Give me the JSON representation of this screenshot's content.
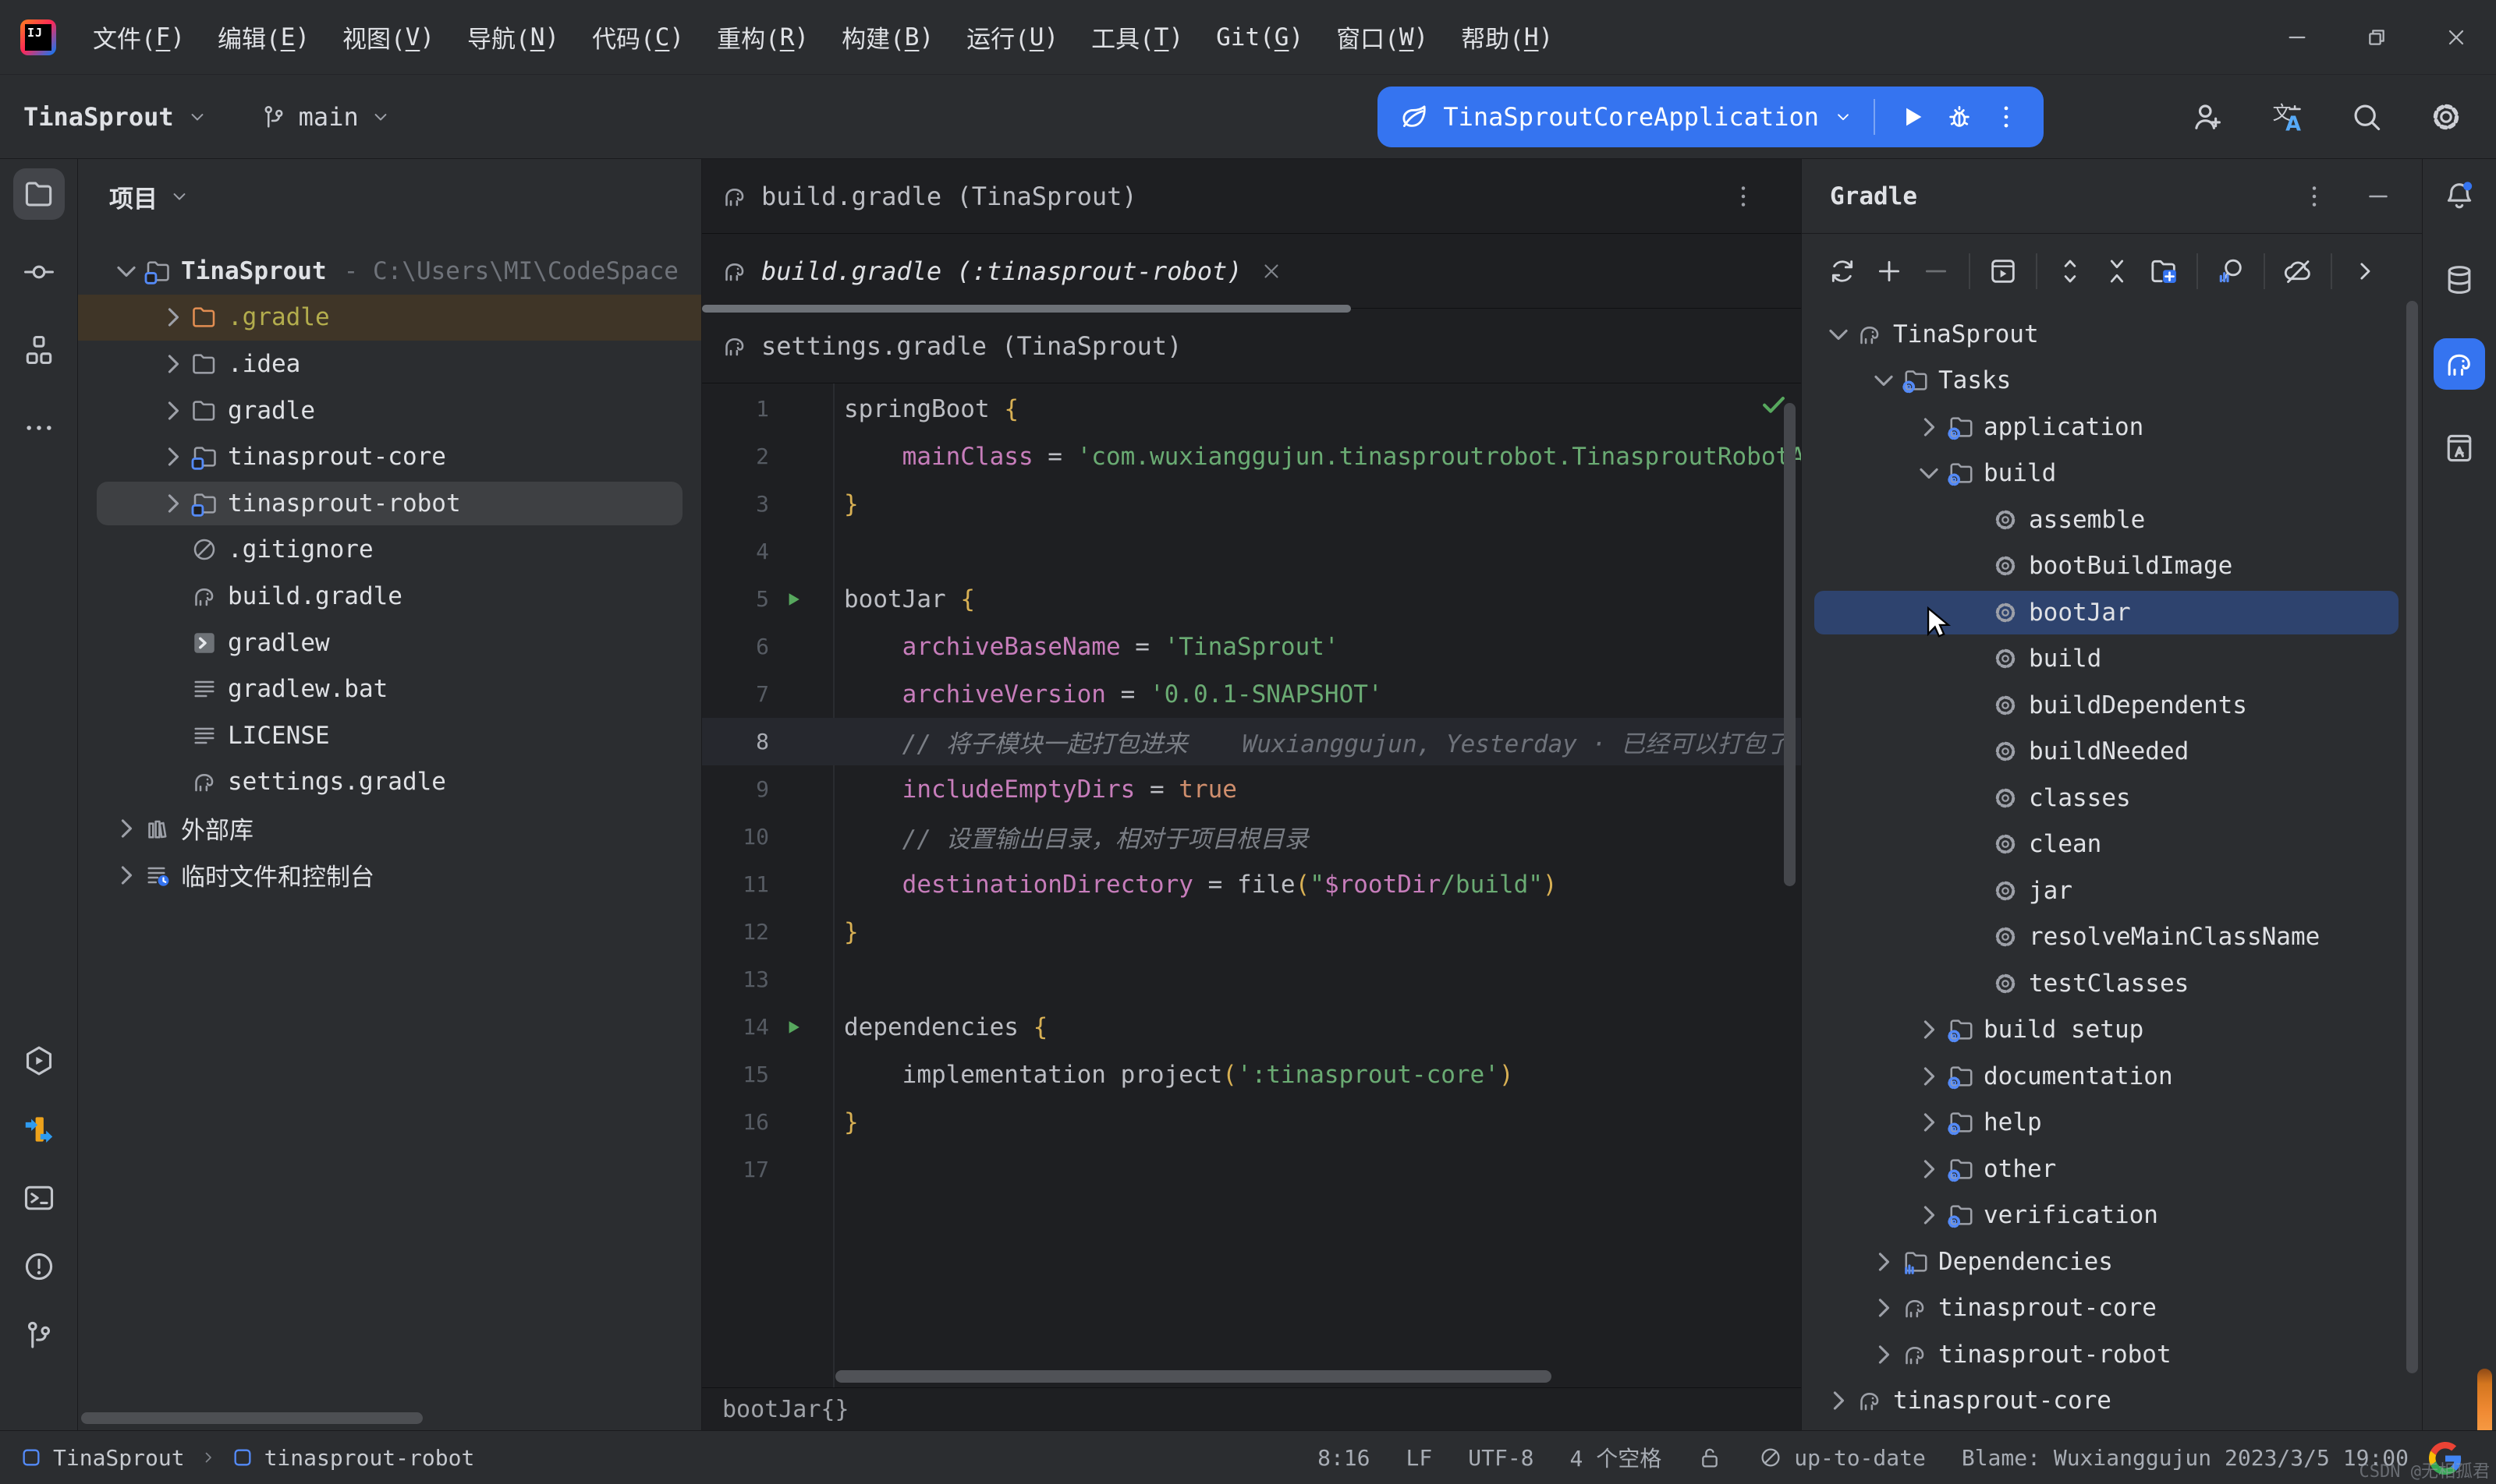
{
  "colors": {
    "accent": "#3574f0",
    "selection": "#2e436e",
    "run-green": "#57a85e",
    "ignored-bg": "#3f3527",
    "ignored-fg": "#b3ad4d",
    "kw": "#c77dbb",
    "str": "#6aab73",
    "num": "#cf8e6d",
    "cmt": "#7a7e85",
    "brace": "#d8b054"
  },
  "titlebar": {
    "logo_text": "IJ",
    "menu": [
      {
        "label": "文件",
        "mnemonic": "F"
      },
      {
        "label": "编辑",
        "mnemonic": "E"
      },
      {
        "label": "视图",
        "mnemonic": "V"
      },
      {
        "label": "导航",
        "mnemonic": "N"
      },
      {
        "label": "代码",
        "mnemonic": "C"
      },
      {
        "label": "重构",
        "mnemonic": "R"
      },
      {
        "label": "构建",
        "mnemonic": "B"
      },
      {
        "label": "运行",
        "mnemonic": "U"
      },
      {
        "label": "工具",
        "mnemonic": "T"
      },
      {
        "label": "Git",
        "mnemonic": "G"
      },
      {
        "label": "窗口",
        "mnemonic": "W"
      },
      {
        "label": "帮助",
        "mnemonic": "H"
      }
    ],
    "window_buttons": [
      "win-minimize",
      "win-restore",
      "win-close"
    ]
  },
  "toolbar": {
    "project_button": "TinaSprout",
    "branch_button": "main",
    "run_config": "TinaSproutCoreApplication",
    "run_buttons": [
      "run",
      "debug",
      "more-vertical"
    ],
    "right_icons": [
      "add-user",
      "translate",
      "search-everywhere",
      "settings"
    ]
  },
  "left_stripe": {
    "top": [
      {
        "icon": "project-folder",
        "active": true
      },
      {
        "icon": "commit"
      },
      {
        "icon": "structure"
      },
      {
        "icon": "more-horizontal"
      }
    ],
    "bottom": [
      {
        "icon": "services"
      },
      {
        "icon": "plugin"
      },
      {
        "icon": "terminal"
      },
      {
        "icon": "problems"
      },
      {
        "icon": "git-branch"
      }
    ]
  },
  "right_stripe": {
    "icons": [
      {
        "icon": "notifications",
        "badge": true
      },
      {
        "icon": "database"
      },
      {
        "icon": "gradle-logo",
        "active": true
      },
      {
        "icon": "documentation"
      }
    ]
  },
  "project_panel": {
    "title": "项目",
    "tree": [
      {
        "label": "TinaSprout",
        "icon": "module-folder",
        "level": 0,
        "chevron": "down",
        "bold": true,
        "suffix": "- C:\\Users\\MI\\CodeSpace"
      },
      {
        "label": ".gradle",
        "icon": "folder",
        "level": 1,
        "chevron": "right",
        "state": "ignored"
      },
      {
        "label": ".idea",
        "icon": "folder",
        "level": 1,
        "chevron": "right"
      },
      {
        "label": "gradle",
        "icon": "folder",
        "level": 1,
        "chevron": "right"
      },
      {
        "label": "tinasprout-core",
        "icon": "module-folder",
        "level": 1,
        "chevron": "right"
      },
      {
        "label": "tinasprout-robot",
        "icon": "module-folder",
        "level": 1,
        "chevron": "right",
        "state": "selected"
      },
      {
        "label": ".gitignore",
        "icon": "ignored-file",
        "level": 1
      },
      {
        "label": "build.gradle",
        "icon": "gradle-file",
        "level": 1
      },
      {
        "label": "gradlew",
        "icon": "console-file",
        "level": 1
      },
      {
        "label": "gradlew.bat",
        "icon": "text-file",
        "level": 1
      },
      {
        "label": "LICENSE",
        "icon": "text-file",
        "level": 1
      },
      {
        "label": "settings.gradle",
        "icon": "gradle-file",
        "level": 1
      },
      {
        "label": "外部库",
        "icon": "library",
        "level": 0,
        "chevron": "right"
      },
      {
        "label": "临时文件和控制台",
        "icon": "scratch",
        "level": 0,
        "chevron": "right"
      }
    ]
  },
  "editor": {
    "tab_rows": [
      {
        "title": "build.gradle (TinaSprout)",
        "icon": "gradle-file",
        "trailing": "more-vertical"
      },
      {
        "title": "build.gradle (:tinasprout-robot)",
        "icon": "gradle-file",
        "close": true,
        "active": true
      },
      {
        "title": "settings.gradle (TinaSprout)",
        "icon": "gradle-file"
      }
    ],
    "inspection": "ok",
    "breadcrumb": "bootJar{}",
    "lines": [
      {
        "n": 1,
        "tokens": [
          [
            "springBoot ",
            "pl"
          ],
          [
            "{",
            "br"
          ]
        ]
      },
      {
        "n": 2,
        "tokens": [
          [
            "    ",
            "pl"
          ],
          [
            "mainClass",
            "kw"
          ],
          [
            " = ",
            "pl"
          ],
          [
            "'com.wuxianggujun.tinasproutrobot.TinasproutRobotApplication'",
            "str"
          ]
        ]
      },
      {
        "n": 3,
        "tokens": [
          [
            "}",
            "br"
          ]
        ]
      },
      {
        "n": 4,
        "tokens": []
      },
      {
        "n": 5,
        "run": true,
        "tokens": [
          [
            "bootJar ",
            "pl"
          ],
          [
            "{",
            "br"
          ]
        ]
      },
      {
        "n": 6,
        "tokens": [
          [
            "    ",
            "pl"
          ],
          [
            "archiveBaseName",
            "kw"
          ],
          [
            " = ",
            "pl"
          ],
          [
            "'TinaSprout'",
            "str"
          ]
        ]
      },
      {
        "n": 7,
        "tokens": [
          [
            "    ",
            "pl"
          ],
          [
            "archiveVersion",
            "kw"
          ],
          [
            " = ",
            "pl"
          ],
          [
            "'0.0.1-SNAPSHOT'",
            "str"
          ]
        ]
      },
      {
        "n": 8,
        "current": true,
        "blame": "Wuxianggujun, Yesterday · 已经可以打包了",
        "tokens": [
          [
            "    ",
            "pl"
          ],
          [
            "// 将子模块一起打包进来",
            "cmt"
          ]
        ]
      },
      {
        "n": 9,
        "tokens": [
          [
            "    ",
            "pl"
          ],
          [
            "includeEmptyDirs",
            "kw"
          ],
          [
            " = ",
            "pl"
          ],
          [
            "true",
            "num"
          ]
        ]
      },
      {
        "n": 10,
        "tokens": [
          [
            "    ",
            "pl"
          ],
          [
            "// 设置输出目录，相对于项目根目录",
            "cmt"
          ]
        ]
      },
      {
        "n": 11,
        "tokens": [
          [
            "    ",
            "pl"
          ],
          [
            "destinationDirectory",
            "kw"
          ],
          [
            " = ",
            "pl"
          ],
          [
            "file",
            "pl"
          ],
          [
            "(",
            "br"
          ],
          [
            "\"",
            "str"
          ],
          [
            "$rootDir",
            "kw"
          ],
          [
            "/build\"",
            "str"
          ],
          [
            ")",
            "br"
          ]
        ]
      },
      {
        "n": 12,
        "tokens": [
          [
            "}",
            "br"
          ]
        ]
      },
      {
        "n": 13,
        "tokens": []
      },
      {
        "n": 14,
        "run": true,
        "tokens": [
          [
            "dependencies ",
            "pl"
          ],
          [
            "{",
            "br"
          ]
        ]
      },
      {
        "n": 15,
        "tokens": [
          [
            "    ",
            "pl"
          ],
          [
            "implementation project",
            "pl"
          ],
          [
            "(",
            "br"
          ],
          [
            "':tinasprout-core'",
            "str"
          ],
          [
            ")",
            "br"
          ]
        ]
      },
      {
        "n": 16,
        "tokens": [
          [
            "}",
            "br"
          ]
        ]
      },
      {
        "n": 17,
        "tokens": []
      }
    ]
  },
  "gradle_panel": {
    "title": "Gradle",
    "header_icons": [
      "more-vertical",
      "minimize-panel"
    ],
    "toolbar": [
      "sync",
      "add",
      {
        "icon": "remove",
        "dim": true
      },
      "sep",
      "run-task",
      "sep",
      "expand-all",
      "collapse-all",
      "group-tasks",
      "sep",
      "analyze",
      "sep",
      "offline",
      "sep",
      "chevron-right"
    ],
    "tree": [
      {
        "label": "TinaSprout",
        "icon": "gradle-file",
        "level": 0,
        "chevron": "down"
      },
      {
        "label": "Tasks",
        "icon": "tasks-folder",
        "level": 1,
        "chevron": "down"
      },
      {
        "label": "application",
        "icon": "tasks-folder",
        "level": 2,
        "chevron": "right"
      },
      {
        "label": "build",
        "icon": "tasks-folder",
        "level": 2,
        "chevron": "down"
      },
      {
        "label": "assemble",
        "icon": "task-gear",
        "level": 3
      },
      {
        "label": "bootBuildImage",
        "icon": "task-gear",
        "level": 3
      },
      {
        "label": "bootJar",
        "icon": "task-gear",
        "level": 3,
        "state": "selected-blue"
      },
      {
        "label": "build",
        "icon": "task-gear",
        "level": 3
      },
      {
        "label": "buildDependents",
        "icon": "task-gear",
        "level": 3
      },
      {
        "label": "buildNeeded",
        "icon": "task-gear",
        "level": 3
      },
      {
        "label": "classes",
        "icon": "task-gear",
        "level": 3
      },
      {
        "label": "clean",
        "icon": "task-gear",
        "level": 3
      },
      {
        "label": "jar",
        "icon": "task-gear",
        "level": 3
      },
      {
        "label": "resolveMainClassName",
        "icon": "task-gear",
        "level": 3
      },
      {
        "label": "testClasses",
        "icon": "task-gear",
        "level": 3
      },
      {
        "label": "build setup",
        "icon": "tasks-folder",
        "level": 2,
        "chevron": "right"
      },
      {
        "label": "documentation",
        "icon": "tasks-folder",
        "level": 2,
        "chevron": "right"
      },
      {
        "label": "help",
        "icon": "tasks-folder",
        "level": 2,
        "chevron": "right"
      },
      {
        "label": "other",
        "icon": "tasks-folder",
        "level": 2,
        "chevron": "right"
      },
      {
        "label": "verification",
        "icon": "tasks-folder",
        "level": 2,
        "chevron": "right"
      },
      {
        "label": "Dependencies",
        "icon": "dependencies-folder",
        "level": 1,
        "chevron": "right"
      },
      {
        "label": "tinasprout-core",
        "icon": "gradle-file",
        "level": 1,
        "chevron": "right"
      },
      {
        "label": "tinasprout-robot",
        "icon": "gradle-file",
        "level": 1,
        "chevron": "right"
      },
      {
        "label": "tinasprout-core",
        "icon": "gradle-file",
        "level": 0,
        "chevron": "right"
      }
    ]
  },
  "status_bar": {
    "left": [
      {
        "icon": "module",
        "label": "TinaSprout"
      },
      {
        "icon": "module",
        "label": "tinasprout-robot"
      }
    ],
    "right": [
      {
        "label": "8:16"
      },
      {
        "label": "LF"
      },
      {
        "label": "UTF-8"
      },
      {
        "label": "4 个空格"
      },
      {
        "icon": "unlocked"
      },
      {
        "icon": "no-problems",
        "label": "up-to-date"
      },
      {
        "label": "Blame: Wuxianggujun 2023/3/5 19:00"
      }
    ],
    "google_icon": "google",
    "watermark": "CSDN @无相孤君"
  }
}
